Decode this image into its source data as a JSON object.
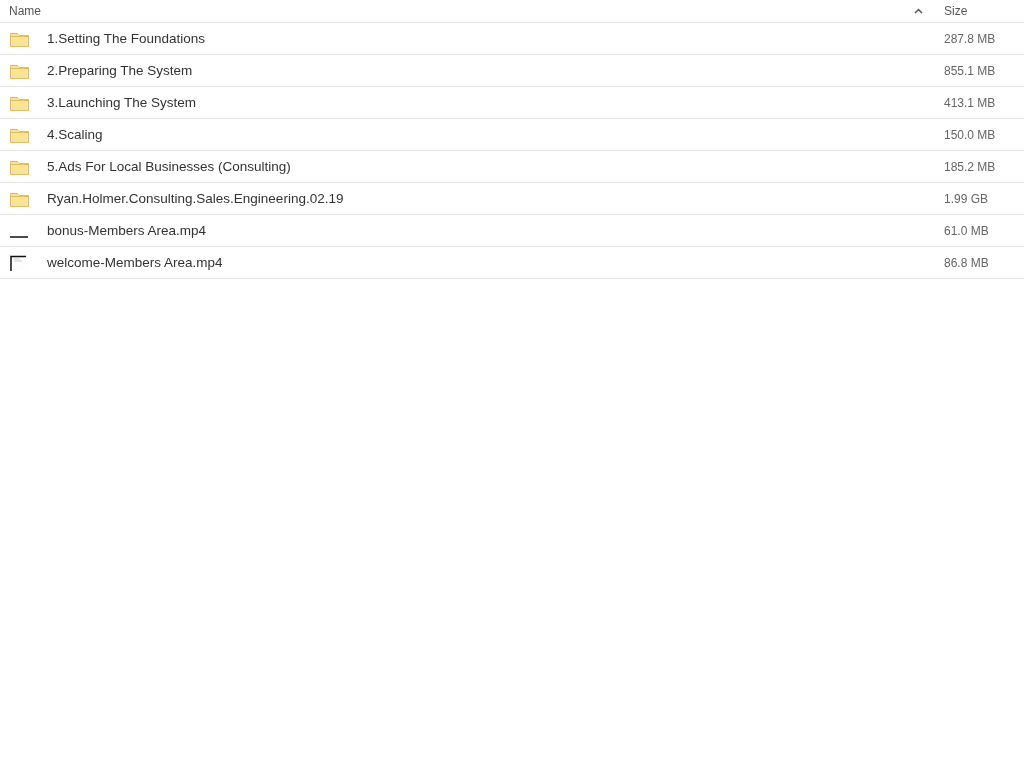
{
  "columns": [
    {
      "label": "Name",
      "sorted": true
    },
    {
      "label": "Size",
      "sorted": false
    }
  ],
  "rows": [
    {
      "kind": "folder",
      "name": "1.Setting The Foundations",
      "size": "287.8 MB"
    },
    {
      "kind": "folder",
      "name": "2.Preparing The System",
      "size": "855.1 MB"
    },
    {
      "kind": "folder",
      "name": "3.Launching The System",
      "size": "413.1 MB"
    },
    {
      "kind": "folder",
      "name": "4.Scaling",
      "size": "150.0 MB"
    },
    {
      "kind": "folder",
      "name": "5.Ads For Local Businesses (Consulting)",
      "size": "185.2 MB"
    },
    {
      "kind": "folder",
      "name": "Ryan.Holmer.Consulting.Sales.Engineering.02.19",
      "size": "1.99 GB"
    },
    {
      "kind": "video",
      "name": "bonus-Members Area.mp4",
      "size": "61.0 MB"
    },
    {
      "kind": "video2",
      "name": "welcome-Members Area.mp4",
      "size": "86.8 MB"
    }
  ]
}
